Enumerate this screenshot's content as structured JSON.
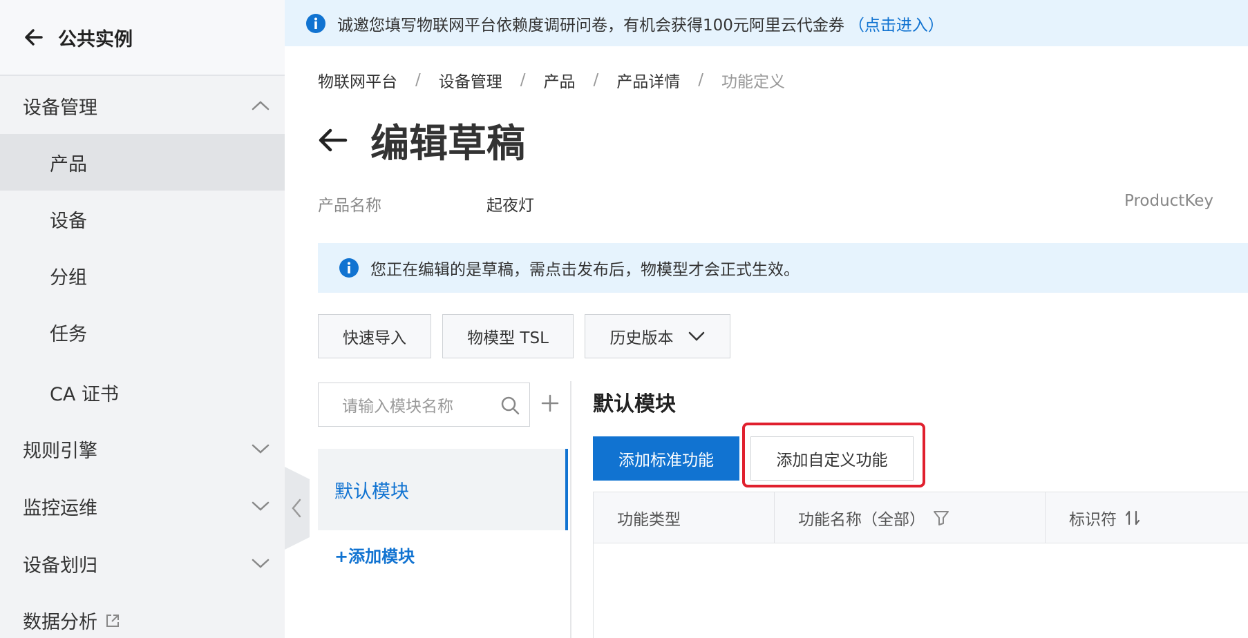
{
  "sidebar": {
    "back_label": "公共实例",
    "groups": [
      {
        "label": "设备管理",
        "expanded": true
      },
      {
        "label": "规则引擎",
        "expanded": false
      },
      {
        "label": "监控运维",
        "expanded": false
      },
      {
        "label": "设备划归",
        "expanded": false
      },
      {
        "label": "数据分析",
        "external": true
      }
    ],
    "sub_items": [
      {
        "label": "产品",
        "active": true
      },
      {
        "label": "设备"
      },
      {
        "label": "分组"
      },
      {
        "label": "任务"
      },
      {
        "label": "CA 证书"
      }
    ]
  },
  "notice": {
    "text": "诚邀您填写物联网平台依赖度调研问卷，有机会获得100元阿里云代金券",
    "link": "（点击进入）"
  },
  "breadcrumb": [
    "物联网平台",
    "设备管理",
    "产品",
    "产品详情",
    "功能定义"
  ],
  "breadcrumb_sep": "/",
  "page": {
    "title": "编辑草稿",
    "product_name_label": "产品名称",
    "product_name_value": "起夜灯",
    "product_key_label": "ProductKey"
  },
  "draft_banner": "您正在编辑的是草稿，需点击发布后，物模型才会正式生效。",
  "toolbar": {
    "quick_import": "快速导入",
    "tsl": "物模型 TSL",
    "history": "历史版本"
  },
  "modules": {
    "search_placeholder": "请输入模块名称",
    "items": [
      "默认模块"
    ],
    "add_label": "+添加模块"
  },
  "content": {
    "section_title": "默认模块",
    "add_standard": "添加标准功能",
    "add_custom": "添加自定义功能",
    "columns": [
      "功能类型",
      "功能名称（全部）",
      "标识符"
    ]
  },
  "colors": {
    "primary": "#1173d1",
    "highlight": "#e0202e",
    "notice_bg": "#e6f3fd"
  }
}
